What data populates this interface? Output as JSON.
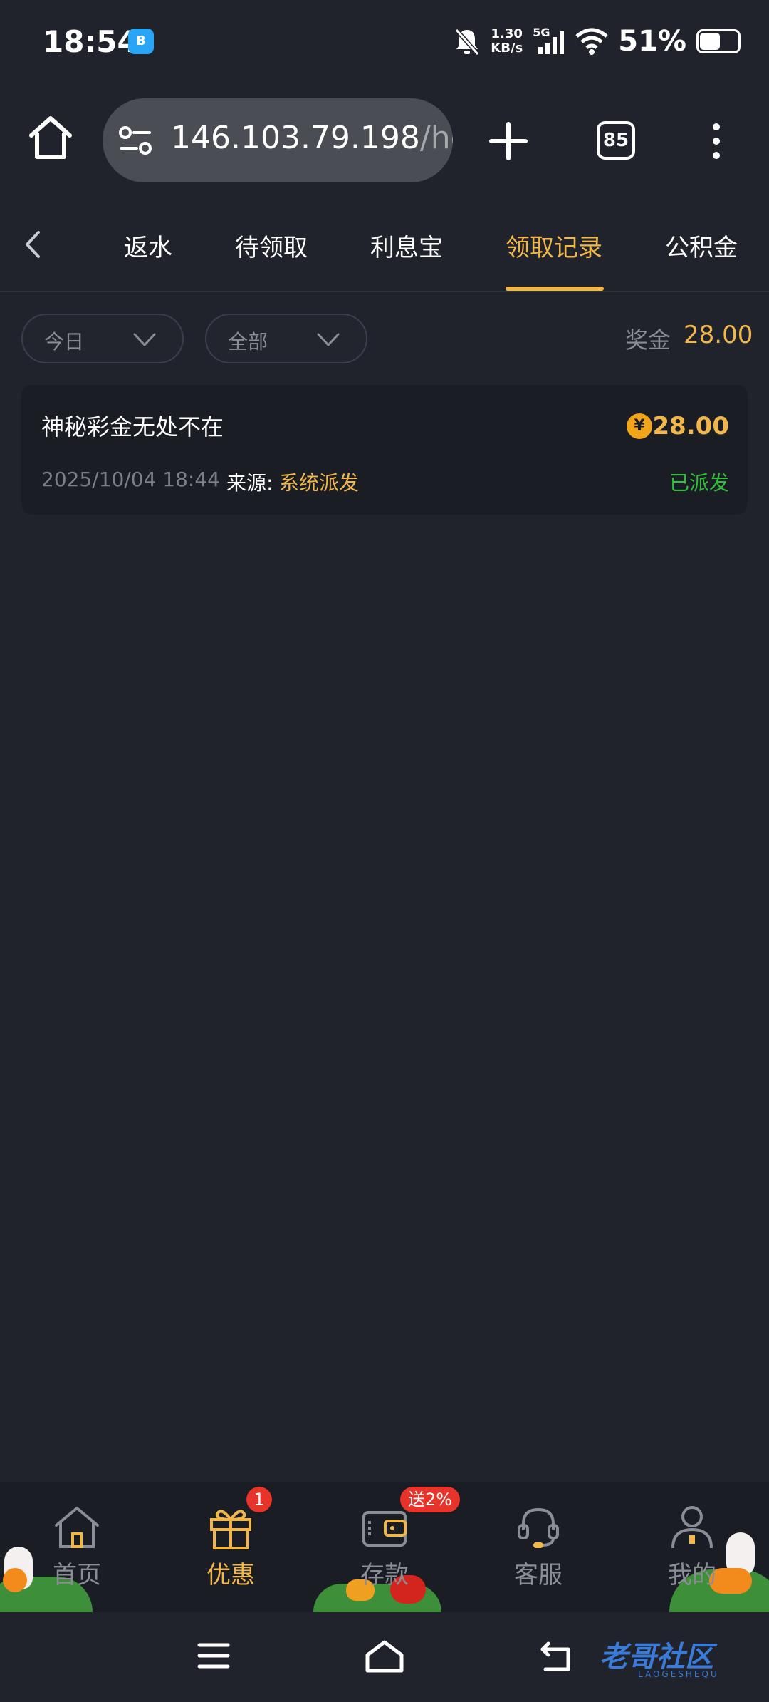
{
  "status_bar": {
    "time": "18:54",
    "app_icon": "app-notification-icon",
    "speed_value": "1.30",
    "speed_unit": "KB/s",
    "network": "5G",
    "battery": "51%"
  },
  "browser": {
    "url_main": "146.103.79.198",
    "url_rest": "/ho",
    "tab_count": "85"
  },
  "tabs": {
    "items": [
      "返水",
      "待领取",
      "利息宝",
      "领取记录",
      "公积金"
    ],
    "active_index": 3
  },
  "filters": {
    "date": "今日",
    "type": "全部",
    "bonus_label": "奖金",
    "bonus_value": "28.00"
  },
  "records": [
    {
      "title": "神秘彩金无处不在",
      "currency_symbol": "¥",
      "amount": "28.00",
      "datetime": "2025/10/04 18:44",
      "source_label": "来源:",
      "source_value": "系统派发",
      "status": "已派发"
    }
  ],
  "bottom_nav": {
    "items": [
      {
        "label": "首页",
        "icon": "home-icon"
      },
      {
        "label": "优惠",
        "icon": "gift-icon",
        "badge": "1"
      },
      {
        "label": "存款",
        "icon": "wallet-icon",
        "badge": "送2%"
      },
      {
        "label": "客服",
        "icon": "headset-icon"
      },
      {
        "label": "我的",
        "icon": "user-icon"
      }
    ],
    "active_index": 1
  },
  "watermark": {
    "text": "老哥社区",
    "sub": "LAOGESHEQU"
  },
  "colors": {
    "background": "#20232c",
    "accent": "#f2b74a",
    "status_success": "#2fbf3a",
    "badge": "#e8332a"
  }
}
